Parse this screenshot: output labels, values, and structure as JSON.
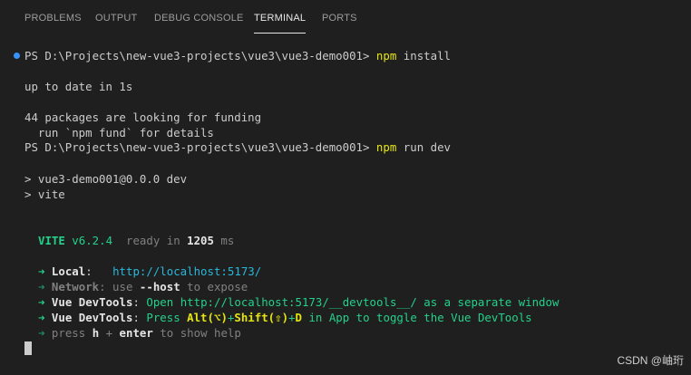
{
  "tabs": {
    "problems": "PROBLEMS",
    "output": "OUTPUT",
    "debug_console": "DEBUG CONSOLE",
    "terminal": "TERMINAL",
    "ports": "PORTS"
  },
  "terminal": {
    "prompt": "PS D:\\Projects\\new-vue3-projects\\vue3\\vue3-demo001> ",
    "cmd1_npm": "npm",
    "cmd1_args": " install",
    "up_to_date": "up to date in 1s",
    "funding_1": "44 packages are looking for funding",
    "funding_2": "  run `npm fund` for details",
    "cmd2_npm": "npm",
    "cmd2_args": " run dev",
    "script_1": "> vue3-demo001@0.0.0 dev",
    "script_2": "> vite",
    "vite_name": "VITE",
    "vite_version": " v6.2.4",
    "ready_in": "  ready in ",
    "ready_ms": "1205",
    "ms": " ms",
    "arrow": "➜ ",
    "local_label": "Local",
    "local_colon": ":   ",
    "local_url": "http://localhost:5173/",
    "network_label": "Network",
    "network_text_1": ": use ",
    "network_host": "--host",
    "network_text_2": " to expose",
    "devtools_label": "Vue DevTools",
    "devtools1_colon": ": ",
    "devtools1_open": "Open ",
    "devtools1_url": "http://localhost:5173/__devtools__/",
    "devtools1_rest": " as a separate window",
    "devtools2_colon": ": ",
    "devtools2_press": "Press ",
    "devtools2_alt": "Alt(⌥)",
    "devtools2_plus1": "+",
    "devtools2_shift": "Shift(⇧)",
    "devtools2_plus2": "+",
    "devtools2_d": "D",
    "devtools2_rest": " in App to toggle the Vue DevTools",
    "help_press": "press ",
    "help_h": "h",
    "help_plus": " + ",
    "help_enter": "enter",
    "help_rest": " to show help"
  },
  "watermark": "CSDN @岫珩",
  "colors": {
    "background": "#1f1f1f",
    "yellow": "#e5e510",
    "green": "#23d18b",
    "cyan": "#29b8db",
    "dim": "#808080",
    "decoration_dot": "#3794ff"
  }
}
